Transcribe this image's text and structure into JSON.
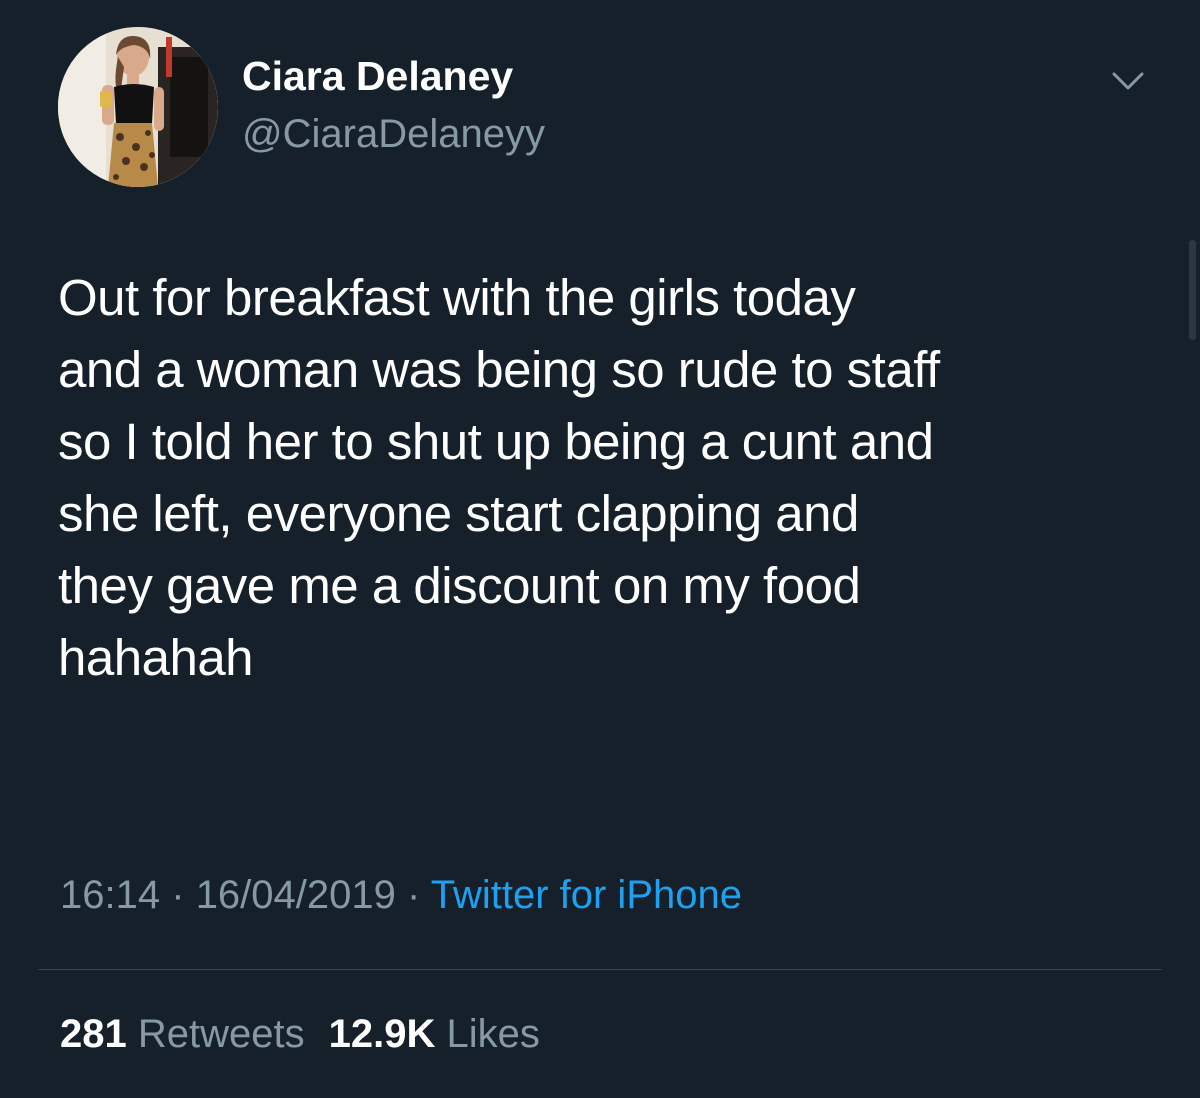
{
  "author": {
    "name": "Ciara Delaney",
    "handle": "@CiaraDelaneyy",
    "avatar_icon": "profile-photo"
  },
  "menu": {
    "icon": "chevron-down-icon"
  },
  "tweet": {
    "lines": [
      "Out for breakfast with the girls today",
      "and a woman was being so rude to staff",
      "so I told her to shut up being a cunt and",
      "she left, everyone start clapping and",
      "they gave me a discount on my food",
      "hahahah"
    ]
  },
  "meta": {
    "time": "16:14",
    "separator": "·",
    "date": "16/04/2019",
    "source": "Twitter for iPhone"
  },
  "stats": {
    "retweets_count": "281",
    "retweets_label": "Retweets",
    "likes_count": "12.9K",
    "likes_label": "Likes"
  },
  "colors": {
    "background": "#15202b",
    "primary_text": "#ffffff",
    "secondary_text": "#8899a6",
    "link": "#1da1f2",
    "divider": "#38444d"
  }
}
